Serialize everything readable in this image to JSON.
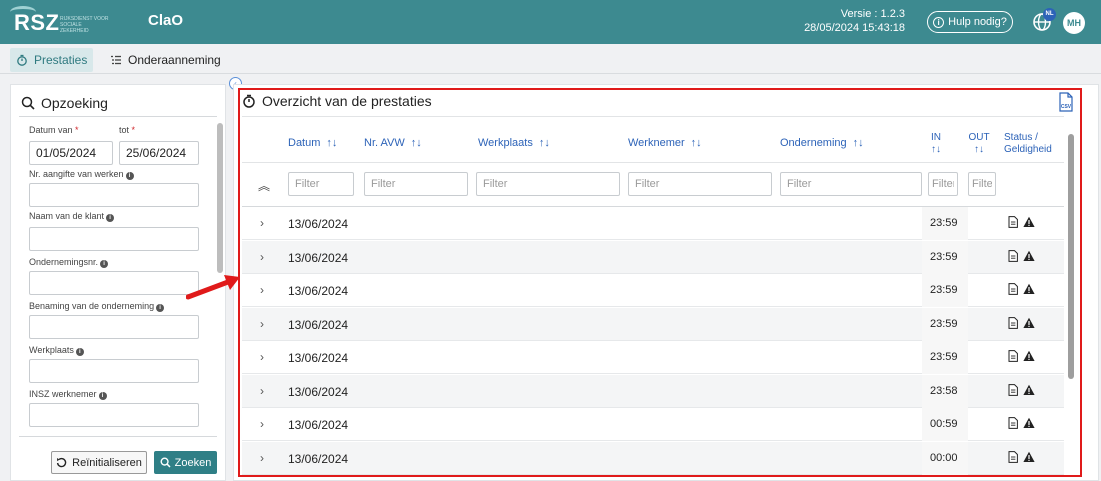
{
  "header": {
    "logo_text": "RSZ",
    "logo_sub": "RIJKSDIENST VOOR SOCIALE ZEKERHEID",
    "app_title": "ClaO",
    "version_line1": "Versie : 1.2.3",
    "version_line2": "28/05/2024 15:43:18",
    "help_label": "Hulp nodig?",
    "lang_badge": "NL",
    "avatar_initials": "MH"
  },
  "tabs": [
    {
      "label": "Prestaties",
      "icon": "stopwatch-icon",
      "active": true
    },
    {
      "label": "Onderaanneming",
      "icon": "list-icon",
      "active": false
    }
  ],
  "search_panel": {
    "title": "Opzoeking",
    "date_from_label": "Datum van",
    "date_from_value": "01/05/2024",
    "date_to_label": "tot",
    "date_to_value": "25/06/2024",
    "required_marker": "*",
    "fields": [
      {
        "label": "Nr. aangifte van werken",
        "value": ""
      },
      {
        "label": "Naam van de klant",
        "value": ""
      },
      {
        "label": "Ondernemingsnr.",
        "value": ""
      },
      {
        "label": "Benaming van de onderneming",
        "value": ""
      },
      {
        "label": "Werkplaats",
        "value": ""
      },
      {
        "label": "INSZ werknemer",
        "value": ""
      }
    ],
    "reset_label": "Reïnitialiseren",
    "search_label": "Zoeken"
  },
  "overview": {
    "title": "Overzicht van de prestaties",
    "export_icon": "csv-icon",
    "columns": {
      "datum": "Datum",
      "nr_avw": "Nr. AVW",
      "werkplaats": "Werkplaats",
      "werknemer": "Werknemer",
      "onderneming": "Onderneming",
      "in": "IN",
      "out": "OUT",
      "status_line1": "Status /",
      "status_line2": "Geldigheid"
    },
    "sort_glyph": "↑↓",
    "filter_placeholder": "Filter",
    "rows": [
      {
        "datum": "13/06/2024",
        "in": "23:59"
      },
      {
        "datum": "13/06/2024",
        "in": "23:59"
      },
      {
        "datum": "13/06/2024",
        "in": "23:59"
      },
      {
        "datum": "13/06/2024",
        "in": "23:59"
      },
      {
        "datum": "13/06/2024",
        "in": "23:59"
      },
      {
        "datum": "13/06/2024",
        "in": "23:58"
      },
      {
        "datum": "13/06/2024",
        "in": "00:59"
      },
      {
        "datum": "13/06/2024",
        "in": "00:00"
      }
    ]
  },
  "colors": {
    "brand": "#3d8a90",
    "link": "#2d63b8",
    "highlight": "#e01a1a"
  }
}
